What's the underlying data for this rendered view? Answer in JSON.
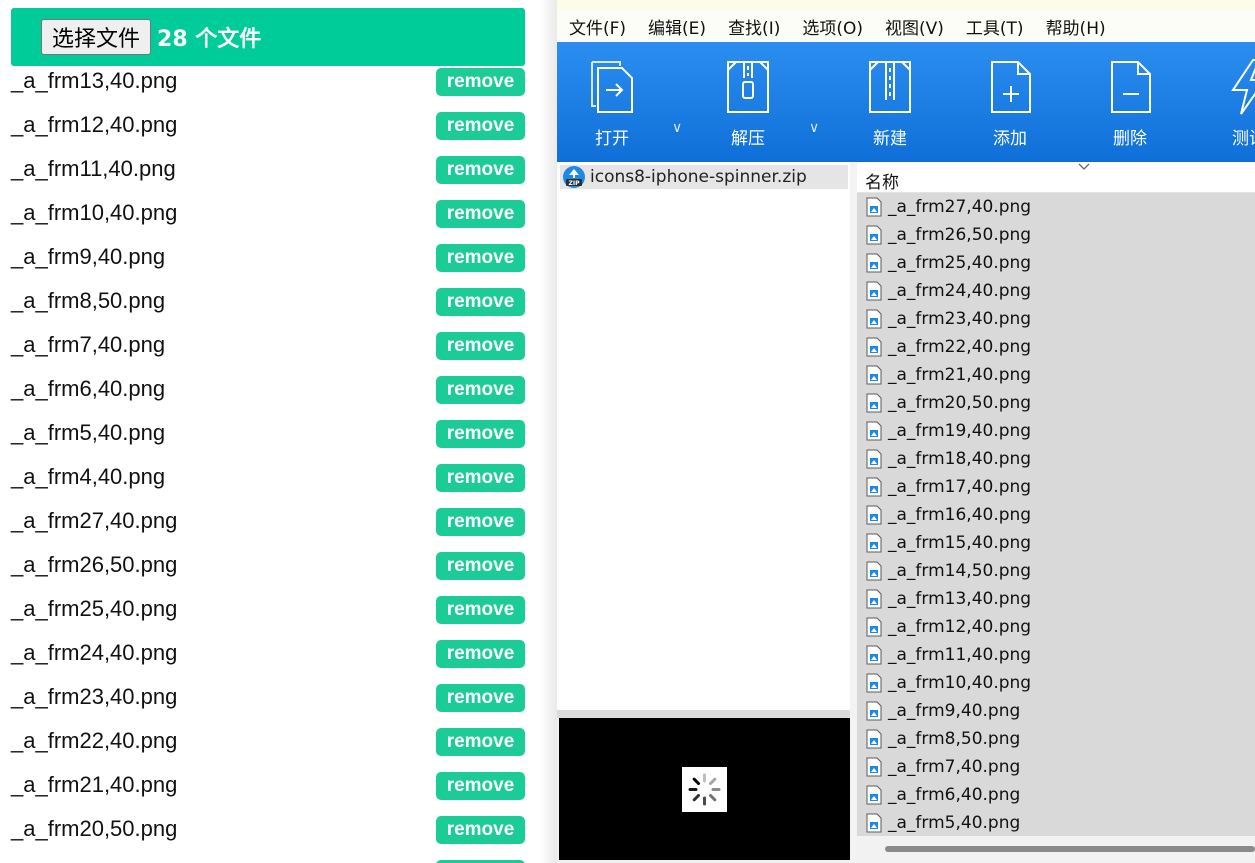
{
  "uploader": {
    "choose_label": "选择文件",
    "count_label": "28 个文件",
    "remove_label": "remove",
    "files": [
      "_a_frm13,40.png",
      "_a_frm12,40.png",
      "_a_frm11,40.png",
      "_a_frm10,40.png",
      "_a_frm9,40.png",
      "_a_frm8,50.png",
      "_a_frm7,40.png",
      "_a_frm6,40.png",
      "_a_frm5,40.png",
      "_a_frm4,40.png",
      "_a_frm27,40.png",
      "_a_frm26,50.png",
      "_a_frm25,40.png",
      "_a_frm24,40.png",
      "_a_frm23,40.png",
      "_a_frm22,40.png",
      "_a_frm21,40.png",
      "_a_frm20,50.png"
    ],
    "accent_color": "#00cc99"
  },
  "archive_app": {
    "menu": [
      "文件(F)",
      "编辑(E)",
      "查找(I)",
      "选项(O)",
      "视图(V)",
      "工具(T)",
      "帮助(H)"
    ],
    "toolbar": {
      "open": "打开",
      "extract": "解压",
      "new": "新建",
      "add": "添加",
      "delete": "删除",
      "test": "测试"
    },
    "toolbar_color": "#1a7fe6",
    "tree": {
      "archive_name": "icons8-iphone-spinner.zip",
      "archive_icon": "zip-icon"
    },
    "list": {
      "column_name": "名称",
      "files": [
        "_a_frm27,40.png",
        "_a_frm26,50.png",
        "_a_frm25,40.png",
        "_a_frm24,40.png",
        "_a_frm23,40.png",
        "_a_frm22,40.png",
        "_a_frm21,40.png",
        "_a_frm20,50.png",
        "_a_frm19,40.png",
        "_a_frm18,40.png",
        "_a_frm17,40.png",
        "_a_frm16,40.png",
        "_a_frm15,40.png",
        "_a_frm14,50.png",
        "_a_frm13,40.png",
        "_a_frm12,40.png",
        "_a_frm11,40.png",
        "_a_frm10,40.png",
        "_a_frm9,40.png",
        "_a_frm8,50.png",
        "_a_frm7,40.png",
        "_a_frm6,40.png",
        "_a_frm5,40.png"
      ]
    },
    "preview_icon": "spinner-icon"
  }
}
